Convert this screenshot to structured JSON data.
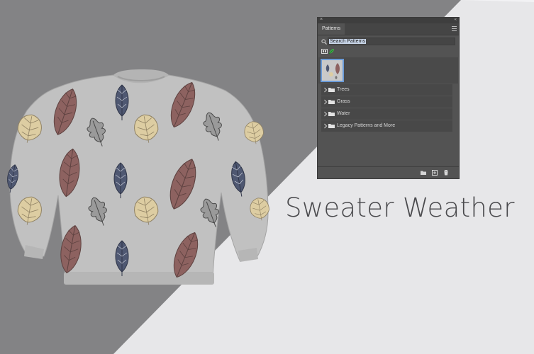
{
  "headline": "Sweater Weather",
  "patterns_panel": {
    "close_icon": "close-icon",
    "collapse_icon": "collapse-icon",
    "tab_label": "Patterns",
    "menu_icon": "panel-menu-icon",
    "search": {
      "value": "Search Patterns",
      "icon": "search-icon"
    },
    "view_icons": [
      "grid-view-icon",
      "leaf-pattern-icon"
    ],
    "groups": [
      {
        "label": "Trees"
      },
      {
        "label": "Grass"
      },
      {
        "label": "Water"
      },
      {
        "label": "Legacy Patterns and More"
      }
    ],
    "footer_icons": [
      "new-group-icon",
      "new-pattern-icon",
      "trash-icon"
    ]
  },
  "colors": {
    "panel_bg": "#535353",
    "selection_highlight": "#6b9bd8",
    "sweater": "#c2c2c2",
    "leaf_red": "#8d6260",
    "leaf_blue": "#4f5872",
    "leaf_cream": "#ddcda2"
  }
}
